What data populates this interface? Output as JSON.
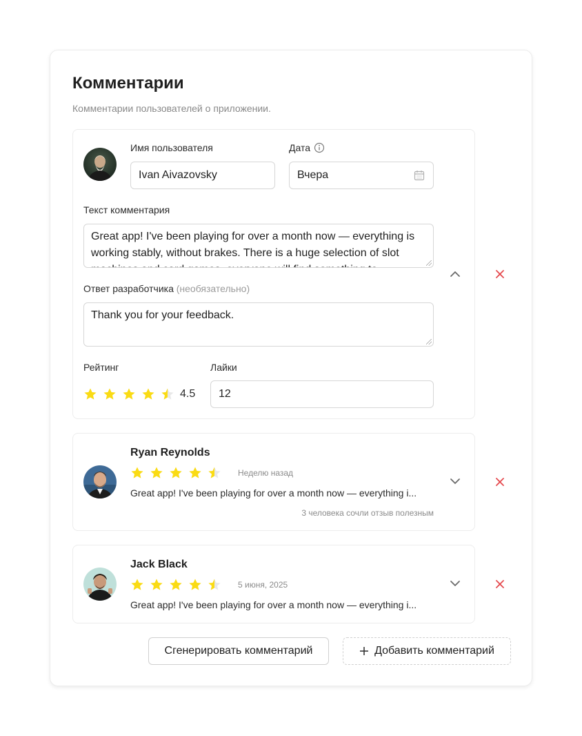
{
  "header": {
    "title": "Комментарии",
    "subtitle": "Комментарии пользователей о приложении."
  },
  "colors": {
    "star": "#fadb14",
    "star_empty": "#e8e8e8",
    "delete": "#e5484d"
  },
  "comments": [
    {
      "expanded": true,
      "avatar": "avatar-aivazovsky",
      "username_label": "Имя пользователя",
      "username": "Ivan Aivazovsky",
      "date_label": "Дата",
      "date_value": "Вчера",
      "text_label": "Текст комментария",
      "text": "Great app! I've been playing for over a month now — everything is working stably, without brakes. There is a huge selection of slot machines and card games, everyone will find something to",
      "reply_label": "Ответ разработчика",
      "reply_optional": "(необязательно)",
      "reply": "Thank you for your feedback.",
      "rating_label": "Рейтинг",
      "rating": 4.5,
      "rating_text": "4.5",
      "likes_label": "Лайки",
      "likes": "12"
    },
    {
      "expanded": false,
      "avatar": "avatar-reynolds",
      "name": "Ryan Reynolds",
      "rating": 4.5,
      "date": "Неделю назад",
      "snippet": "Great app! I've been playing for over a month now — everything i...",
      "helpful": "3 человека сочли отзыв полезным"
    },
    {
      "expanded": false,
      "avatar": "avatar-black",
      "name": "Jack Black",
      "rating": 4.5,
      "date": "5 июня, 2025",
      "snippet": "Great app! I've been playing for over a month now — everything i..."
    }
  ],
  "actions": {
    "generate_label": "Сгенерировать комментарий",
    "add_label": "Добавить комментарий"
  }
}
